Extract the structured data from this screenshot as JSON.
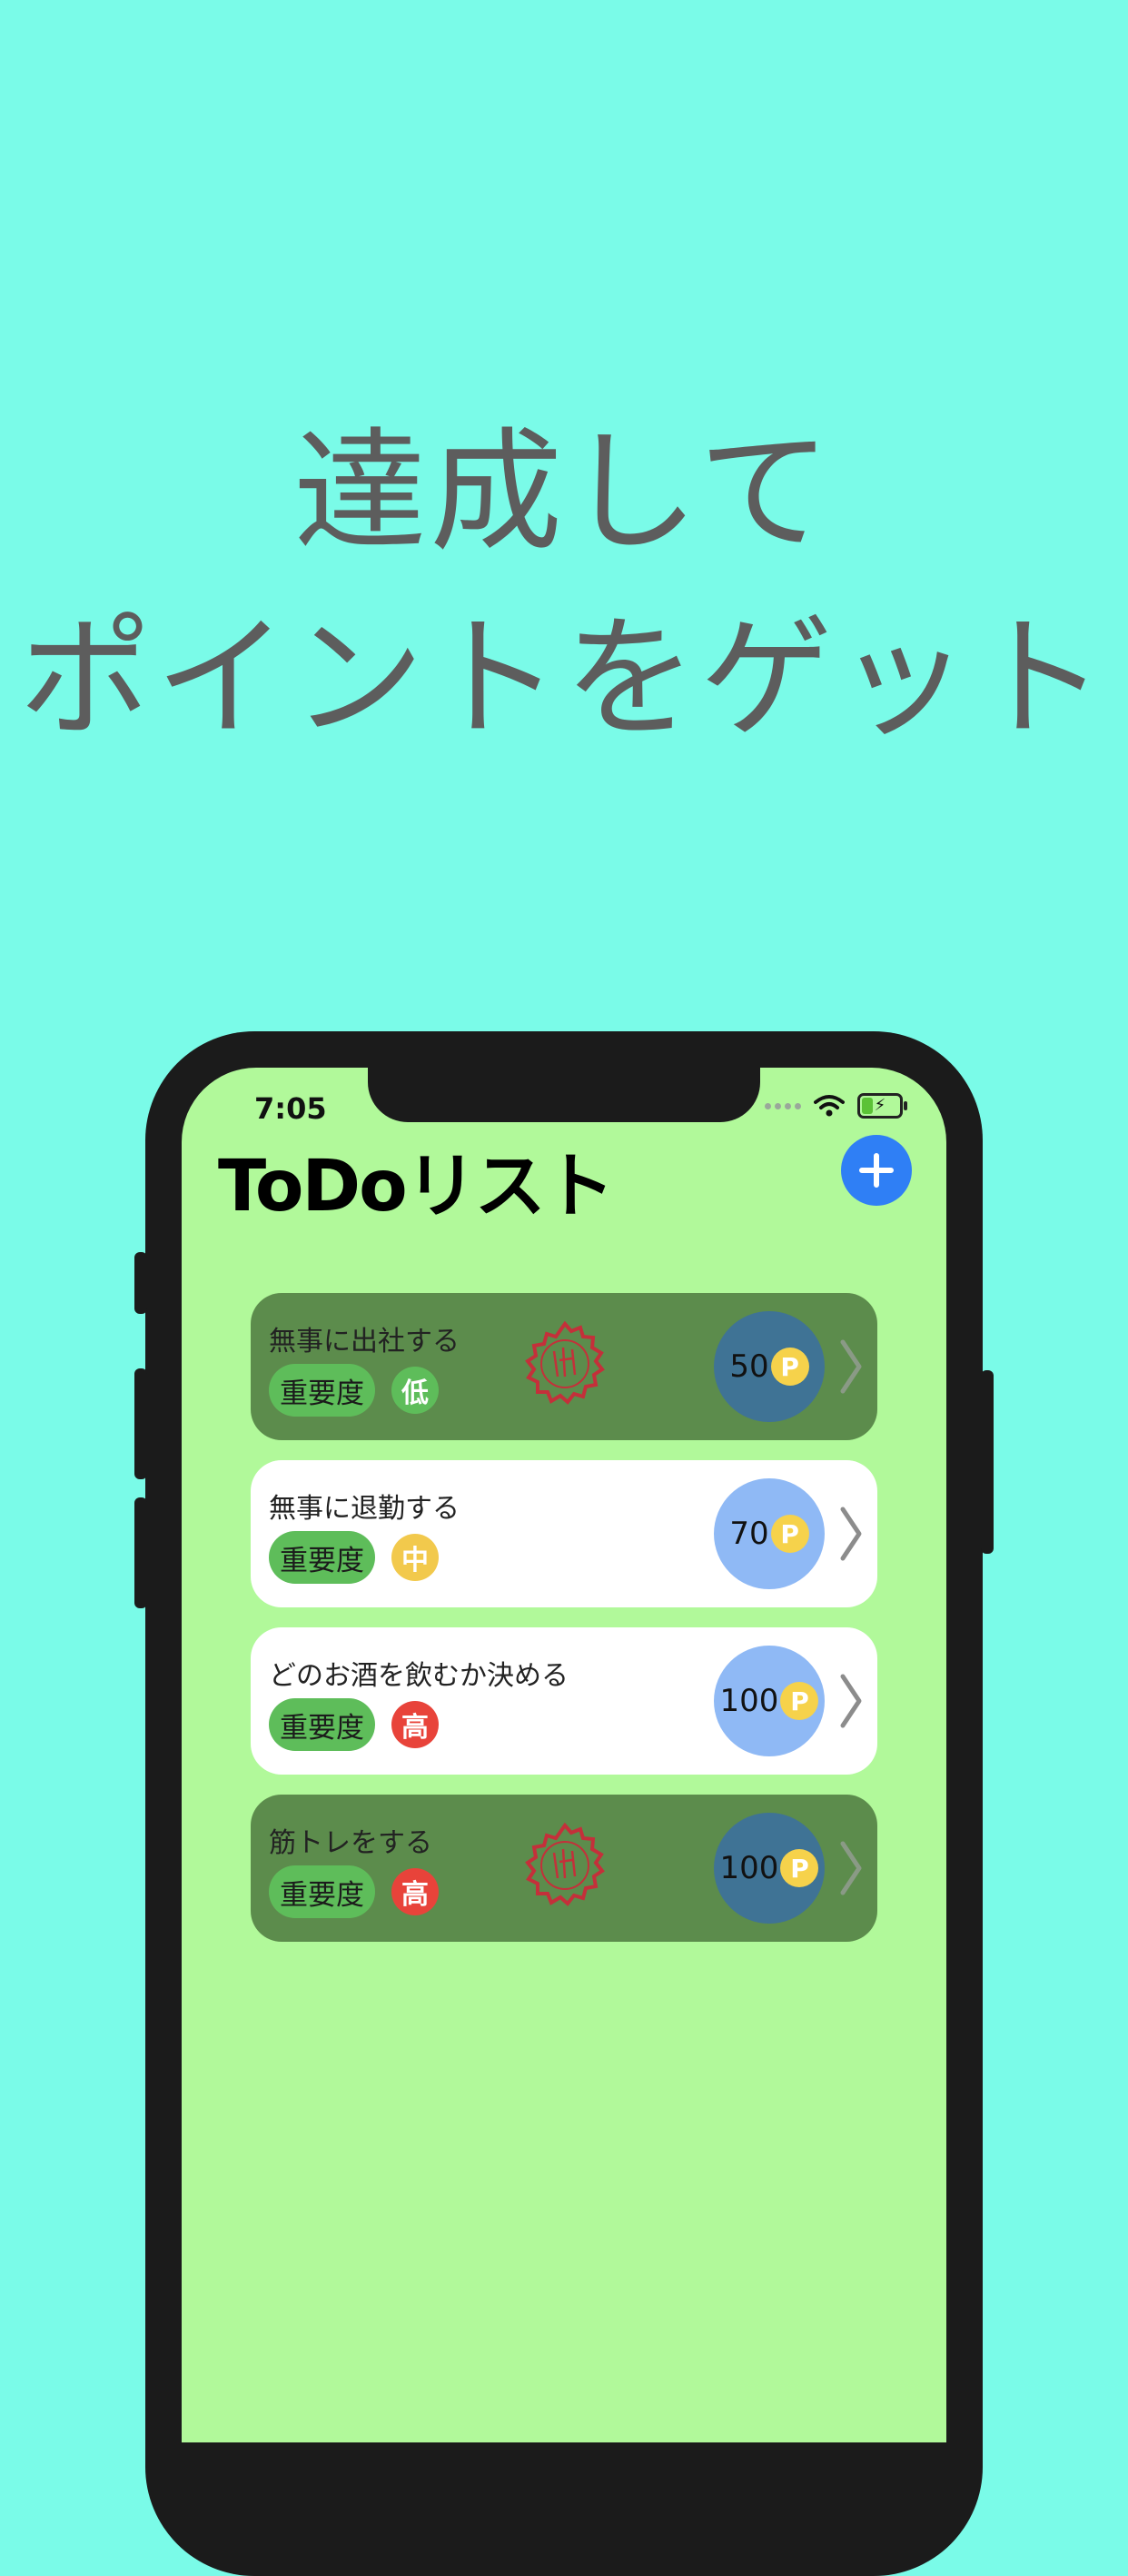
{
  "headline": {
    "line1": "達成して",
    "line2": "ポイントをゲット"
  },
  "status_bar": {
    "time": "7:05",
    "battery_bolt": "⚡"
  },
  "app": {
    "title": "ToDoリスト",
    "add_button_icon": "plus-icon"
  },
  "colors": {
    "background": "#7afbe8",
    "screen": "#b1f99a",
    "accent": "#2f7ff5",
    "low": "#5ebd5a",
    "mid": "#f2c94c",
    "high": "#e8433a",
    "done_card": "#5c8c4c",
    "stamp": "#c4303a"
  },
  "tasks": [
    {
      "title": "無事に出社する",
      "importance_label": "重要度",
      "importance": "低",
      "points": "50",
      "coin": "P",
      "completed": true,
      "stamp_icon": "completed-stamp-icon"
    },
    {
      "title": "無事に退勤する",
      "importance_label": "重要度",
      "importance": "中",
      "points": "70",
      "coin": "P",
      "completed": false
    },
    {
      "title": "どのお酒を飲むか決める",
      "importance_label": "重要度",
      "importance": "高",
      "points": "100",
      "coin": "P",
      "completed": false
    },
    {
      "title": "筋トレをする",
      "importance_label": "重要度",
      "importance": "高",
      "points": "100",
      "coin": "P",
      "completed": true,
      "stamp_icon": "completed-stamp-icon"
    }
  ]
}
